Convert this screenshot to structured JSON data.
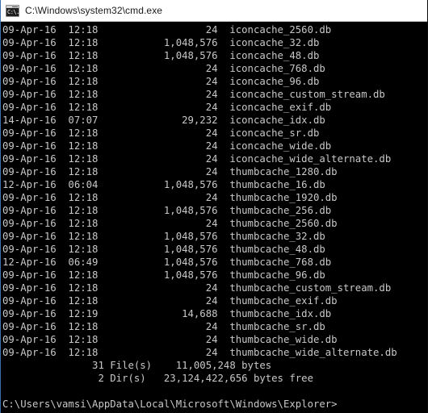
{
  "window": {
    "title": "C:\\Windows\\system32\\cmd.exe",
    "icon": "cmd-console-icon",
    "icon_glyph": "C:\\.",
    "titlebar_bg": "#ffffff",
    "titlebar_fg": "#1a1a1a",
    "console_bg": "#000000",
    "console_fg": "#c8c8c8",
    "border_color": "#3b6ea5"
  },
  "console": {
    "columns": {
      "date_col": 0,
      "time_col": 11,
      "size_right_col": 36,
      "name_col": 38
    },
    "directory_listing": [
      {
        "date": "09-Apr-16",
        "time": "12:18",
        "size": "24",
        "name": "iconcache_2560.db"
      },
      {
        "date": "09-Apr-16",
        "time": "12:18",
        "size": "1,048,576",
        "name": "iconcache_32.db"
      },
      {
        "date": "09-Apr-16",
        "time": "12:18",
        "size": "1,048,576",
        "name": "iconcache_48.db"
      },
      {
        "date": "09-Apr-16",
        "time": "12:18",
        "size": "24",
        "name": "iconcache_768.db"
      },
      {
        "date": "09-Apr-16",
        "time": "12:18",
        "size": "24",
        "name": "iconcache_96.db"
      },
      {
        "date": "09-Apr-16",
        "time": "12:18",
        "size": "24",
        "name": "iconcache_custom_stream.db"
      },
      {
        "date": "09-Apr-16",
        "time": "12:18",
        "size": "24",
        "name": "iconcache_exif.db"
      },
      {
        "date": "14-Apr-16",
        "time": "07:07",
        "size": "29,232",
        "name": "iconcache_idx.db"
      },
      {
        "date": "09-Apr-16",
        "time": "12:18",
        "size": "24",
        "name": "iconcache_sr.db"
      },
      {
        "date": "09-Apr-16",
        "time": "12:18",
        "size": "24",
        "name": "iconcache_wide.db"
      },
      {
        "date": "09-Apr-16",
        "time": "12:18",
        "size": "24",
        "name": "iconcache_wide_alternate.db"
      },
      {
        "date": "09-Apr-16",
        "time": "12:18",
        "size": "24",
        "name": "thumbcache_1280.db"
      },
      {
        "date": "12-Apr-16",
        "time": "06:04",
        "size": "1,048,576",
        "name": "thumbcache_16.db"
      },
      {
        "date": "09-Apr-16",
        "time": "12:18",
        "size": "24",
        "name": "thumbcache_1920.db"
      },
      {
        "date": "09-Apr-16",
        "time": "12:18",
        "size": "1,048,576",
        "name": "thumbcache_256.db"
      },
      {
        "date": "09-Apr-16",
        "time": "12:18",
        "size": "24",
        "name": "thumbcache_2560.db"
      },
      {
        "date": "09-Apr-16",
        "time": "12:18",
        "size": "1,048,576",
        "name": "thumbcache_32.db"
      },
      {
        "date": "09-Apr-16",
        "time": "12:18",
        "size": "1,048,576",
        "name": "thumbcache_48.db"
      },
      {
        "date": "12-Apr-16",
        "time": "06:49",
        "size": "1,048,576",
        "name": "thumbcache_768.db"
      },
      {
        "date": "09-Apr-16",
        "time": "12:18",
        "size": "1,048,576",
        "name": "thumbcache_96.db"
      },
      {
        "date": "09-Apr-16",
        "time": "12:18",
        "size": "24",
        "name": "thumbcache_custom_stream.db"
      },
      {
        "date": "09-Apr-16",
        "time": "12:18",
        "size": "24",
        "name": "thumbcache_exif.db"
      },
      {
        "date": "09-Apr-16",
        "time": "12:19",
        "size": "14,688",
        "name": "thumbcache_idx.db"
      },
      {
        "date": "09-Apr-16",
        "time": "12:18",
        "size": "24",
        "name": "thumbcache_sr.db"
      },
      {
        "date": "09-Apr-16",
        "time": "12:18",
        "size": "24",
        "name": "thumbcache_wide.db"
      },
      {
        "date": "09-Apr-16",
        "time": "12:18",
        "size": "24",
        "name": "thumbcache_wide_alternate.db"
      }
    ],
    "summary": {
      "file_count": "31",
      "file_label": "File(s)",
      "total_bytes": "11,005,248",
      "bytes_label": "bytes",
      "dir_count": "2",
      "dir_label": "Dir(s)",
      "free_bytes": "23,124,422,656",
      "free_label": "bytes free"
    },
    "prompt": "C:\\Users\\vamsi\\AppData\\Local\\Microsoft\\Windows\\Explorer>"
  }
}
